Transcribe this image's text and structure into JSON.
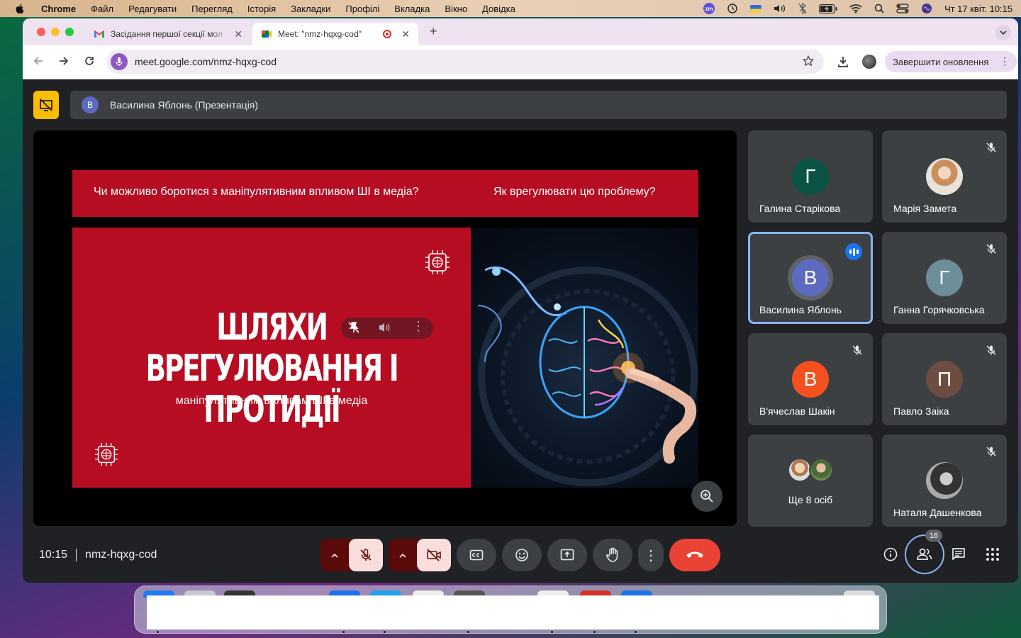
{
  "menubar": {
    "app": "Chrome",
    "items": [
      "Файл",
      "Редагувати",
      "Перегляд",
      "Історія",
      "Закладки",
      "Профілі",
      "Вкладка",
      "Вікно",
      "Довідка"
    ],
    "clock": "Чт 17 квіт.  10:15",
    "zoom_label": "zm"
  },
  "browser": {
    "tabs": [
      {
        "title": "Засідання першої секції мол",
        "favicon": "gmail-icon"
      },
      {
        "title": "Meet: \"nmz-hqxg-cod\"",
        "favicon": "meet-icon",
        "recording": true
      }
    ],
    "url": "meet.google.com/nmz-hqxg-cod",
    "update_label": "Завершити оновлення"
  },
  "meet": {
    "presenter_initial": "В",
    "presenter_title": "Василина Яблонь (Презентація)",
    "slide": {
      "question1": "Чи можливо боротися з маніпулятивним впливом ШІ в медіа?",
      "question2": "Як врегулювати цю проблему?",
      "heading_line1": "ШЛЯХИ ВРЕГУЛЮВАННЯ І",
      "heading_line2": "ПРОТИДІЇ",
      "subheading": "маніпулятивним впливам ШІ в медіа"
    },
    "participants": [
      {
        "initial": "Г",
        "name": "Галина Старікова",
        "color": "#0b5345",
        "muted": false
      },
      {
        "initial": "",
        "name": "Марія Замета",
        "color": "#c9a27a",
        "muted": true,
        "photo": true
      },
      {
        "initial": "В",
        "name": "Василина Яблонь",
        "color": "#5c6bc0",
        "muted": false,
        "speaking": true
      },
      {
        "initial": "Г",
        "name": "Ганна Горячковська",
        "color": "#6b8e98",
        "muted": true
      },
      {
        "initial": "В",
        "name": "В'ячеслав Шакін",
        "color": "#f4511e",
        "muted": true
      },
      {
        "initial": "П",
        "name": "Павло Заіка",
        "color": "#6d4c41",
        "muted": true
      },
      {
        "initial": "",
        "name": "Ще 8 осіб",
        "color": "#7a6a5a",
        "muted": false,
        "group": true
      },
      {
        "initial": "",
        "name": "Наталя Дашенкова",
        "color": "#8a8a8a",
        "muted": true,
        "photo": true
      }
    ],
    "time": "10:15",
    "meeting_code": "nmz-hqxg-cod",
    "people_count": "16"
  }
}
